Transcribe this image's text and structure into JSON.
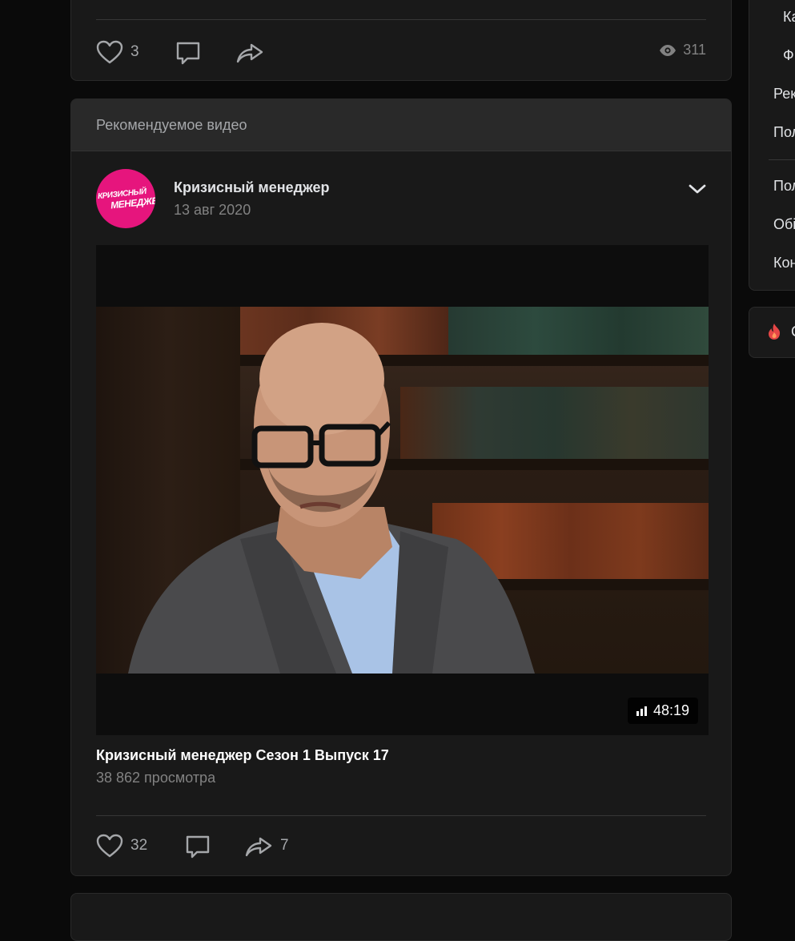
{
  "top_post": {
    "likes": "3",
    "views": "311"
  },
  "recommended": {
    "header": "Рекомендуемое видео",
    "avatar_line1": "КРИЗИСНЫЙ",
    "avatar_line2": "МЕНЕДЖЕР",
    "author": "Кризисный менеджер",
    "date": "13 авг 2020",
    "video": {
      "duration": "48:19",
      "title": "Кризисный менеджер Сезон 1 Выпуск 17",
      "views": "38 862 просмотра"
    },
    "likes": "32",
    "shares": "7"
  },
  "sidebar": {
    "items": [
      "Ка",
      "Ф",
      "Рек",
      "Пол",
      "Пол",
      "Обі",
      "Кон"
    ],
    "trending_label": "С"
  },
  "icons": {
    "like": "heart-icon",
    "comment": "comment-icon",
    "share": "share-icon",
    "views": "eye-icon",
    "more": "chevron-down-icon",
    "trending": "fire-icon",
    "quality": "signal-bars-icon"
  }
}
